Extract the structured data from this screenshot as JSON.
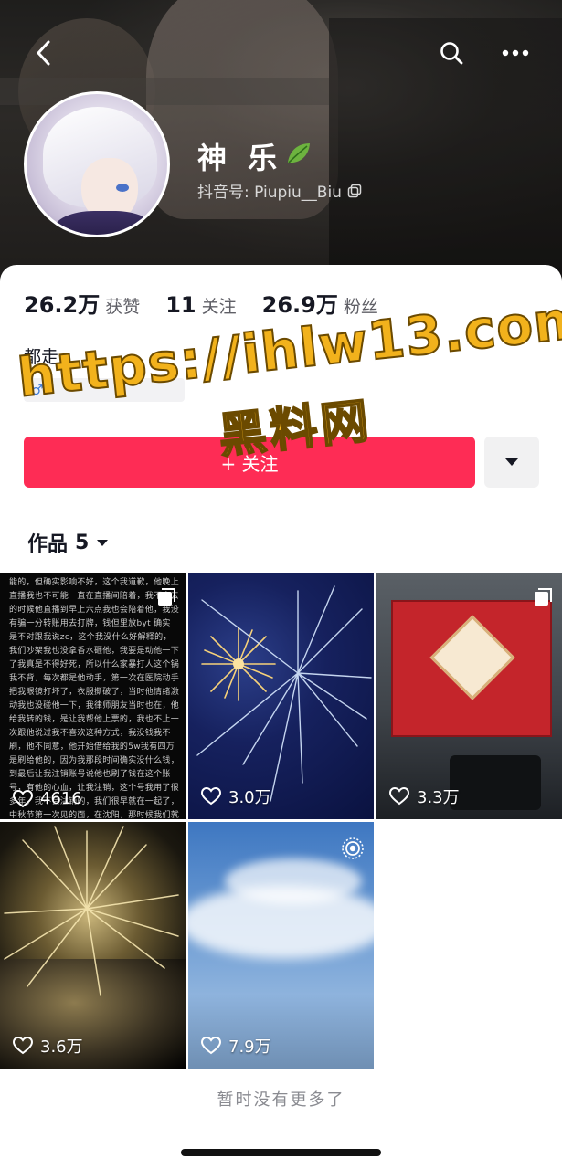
{
  "header": {
    "back_icon": "chevron-left-icon",
    "search_icon": "search-icon",
    "more_icon": "more-dots-icon"
  },
  "profile": {
    "name": "神 乐",
    "name_emoji": "leaf-icon",
    "douyin_id_label": "抖音号: Piupiu__Biu",
    "copy_icon": "copy-icon",
    "bio": "都走",
    "tag_icon": "male-icon"
  },
  "stats": [
    {
      "value": "26.2万",
      "label": "获赞"
    },
    {
      "value": "11",
      "label": "关注"
    },
    {
      "value": "26.9万",
      "label": "粉丝"
    }
  ],
  "actions": {
    "follow_label": "+ 关注",
    "dropdown_icon": "caret-down-icon"
  },
  "tabs": {
    "works_label": "作品",
    "works_count": "5"
  },
  "watermark": {
    "line1": "https://ihlw13.com",
    "line2": "黑料网"
  },
  "videos": [
    {
      "likes": "4616",
      "type": "text-image"
    },
    {
      "likes": "3.0万",
      "type": "fireworks-blue"
    },
    {
      "likes": "3.3万",
      "type": "red-package"
    },
    {
      "likes": "3.6万",
      "type": "fireworks-gold"
    },
    {
      "likes": "7.9万",
      "type": "sky"
    }
  ],
  "video1_text": "能的，但确实影响不好，这个我道歉，他晚上直播我也不可能一直在直播间陪着，我不出去的时候他直播到早上六点我也会陪着他，我没有骗一分转账用去打牌，钱但里放byt 确实是不对跟我说zc，这个我没什么好解释的，我们吵架我也没拿香水砸他，我要是动他一下了我真是不得好死，所以什么家暴打人这个锅我不背，每次都是他动手，第一次在医院动手把我眼镜打坏了，衣服撕破了，当时他情绪激动我也没碰他一下，我律师朋友当时也在，他给我转的钱，是让我帮他上票的，我也不止一次跟他说过我不喜欢这种方式，我没钱我不刷，他不同意，他开始借给我的5w我有四万是刷给他的，因为我那段时间确实没什么钱，到最后让我注销账号说他也刷了钱在这个账号，有他的心血，让我注销，这个号我用了很多年，我不会注销的，我们很早就在一起了，中秋节第一次见的面，在沈阳，那时候我们就住在一起了，所以之后他跟大哥的事我是没法容忍的，我们也很早就分开了，在分手官宣视频之前我们就已经分开了，还有戒指的事情，我记得很清楚，结婚证也是他自己去拿的戒指，当时我不知道",
  "footer": {
    "no_more": "暂时没有更多了"
  },
  "colors": {
    "accent": "#fe2c55",
    "watermark": "#f2b21c"
  }
}
